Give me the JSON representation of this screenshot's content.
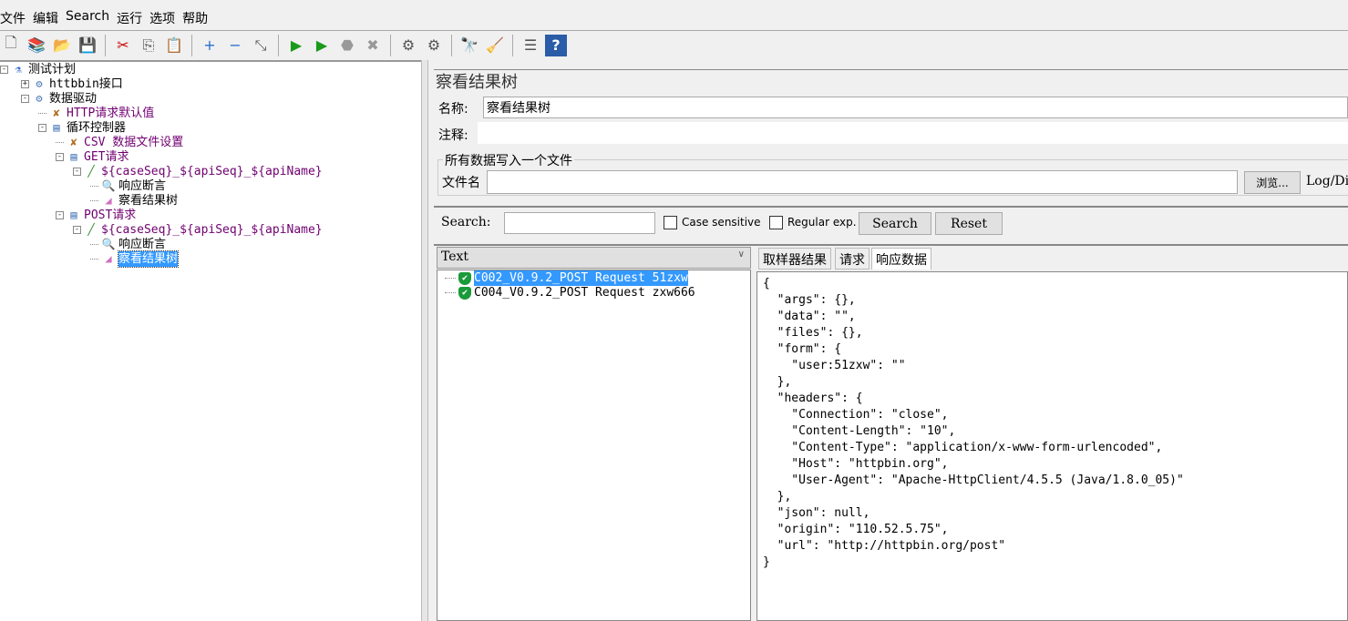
{
  "menu": [
    "文件",
    "编辑",
    "Search",
    "运行",
    "选项",
    "帮助"
  ],
  "toolbar_icons": [
    "new-icon",
    "templates-icon",
    "open-icon",
    "save-icon",
    "cut-icon",
    "copy-icon",
    "paste-icon",
    "expand-icon",
    "collapse-icon",
    "toggle-icon",
    "start-icon",
    "start-no-pause-icon",
    "stop-icon",
    "shutdown-icon",
    "clear-icon",
    "clear-all-icon",
    "search-icon",
    "reset-search-icon",
    "function-helper-icon",
    "help-icon"
  ],
  "tree": [
    {
      "label": "测试计划",
      "level": 0,
      "icon": "flask-icon",
      "exp": "-"
    },
    {
      "label": "httbbin接口",
      "level": 1,
      "icon": "gear-icon",
      "exp": "+"
    },
    {
      "label": "数据驱动",
      "level": 1,
      "icon": "gear-icon",
      "exp": "-"
    },
    {
      "label": "HTTP请求默认值",
      "level": 2,
      "icon": "wrench-icon",
      "color": "#700070"
    },
    {
      "label": "循环控制器",
      "level": 2,
      "icon": "controller-icon",
      "exp": "-"
    },
    {
      "label": "CSV 数据文件设置",
      "level": 3,
      "icon": "wrench-icon",
      "color": "#700070"
    },
    {
      "label": "GET请求",
      "level": 3,
      "icon": "controller-icon",
      "exp": "-",
      "color": "#700070"
    },
    {
      "label": "${caseSeq}_${apiSeq}_${apiName}",
      "level": 4,
      "icon": "sampler-icon",
      "exp": "-",
      "color": "#700070"
    },
    {
      "label": "响应断言",
      "level": 5,
      "icon": "magnifier-icon"
    },
    {
      "label": "察看结果树",
      "level": 5,
      "icon": "graph-icon"
    },
    {
      "label": "POST请求",
      "level": 3,
      "icon": "controller-icon",
      "exp": "-",
      "color": "#700070"
    },
    {
      "label": "${caseSeq}_${apiSeq}_${apiName}",
      "level": 4,
      "icon": "sampler-icon",
      "exp": "-",
      "color": "#700070"
    },
    {
      "label": "响应断言",
      "level": 5,
      "icon": "magnifier-icon"
    },
    {
      "label": "察看结果树",
      "level": 5,
      "icon": "graph-icon",
      "selected": true
    }
  ],
  "panel": {
    "title": "察看结果树",
    "name_label": "名称:",
    "name_value": "察看结果树",
    "comment_label": "注释:",
    "comment_value": "",
    "file_group": "所有数据写入一个文件",
    "filename_label": "文件名",
    "filename_value": "",
    "browse": "浏览...",
    "log_label": "Log/Di",
    "search_label": "Search:",
    "search_value": "",
    "case_sensitive": "Case sensitive",
    "regex": "Regular exp.",
    "search_btn": "Search",
    "reset_btn": "Reset",
    "renderer": "Text",
    "tabs": [
      "取样器结果",
      "请求",
      "响应数据"
    ],
    "active_tab": "响应数据",
    "results": [
      {
        "label": "C002_V0.9.2_POST Request 51zxw",
        "status": "success",
        "selected": true
      },
      {
        "label": "C004_V0.9.2_POST Request zxw666",
        "status": "success"
      }
    ],
    "response": "{\n  \"args\": {},\n  \"data\": \"\",\n  \"files\": {},\n  \"form\": {\n    \"user:51zxw\": \"\"\n  },\n  \"headers\": {\n    \"Connection\": \"close\",\n    \"Content-Length\": \"10\",\n    \"Content-Type\": \"application/x-www-form-urlencoded\",\n    \"Host\": \"httpbin.org\",\n    \"User-Agent\": \"Apache-HttpClient/4.5.5 (Java/1.8.0_05)\"\n  },\n  \"json\": null,\n  \"origin\": \"110.52.5.75\",\n  \"url\": \"http://httpbin.org/post\"\n}"
  }
}
